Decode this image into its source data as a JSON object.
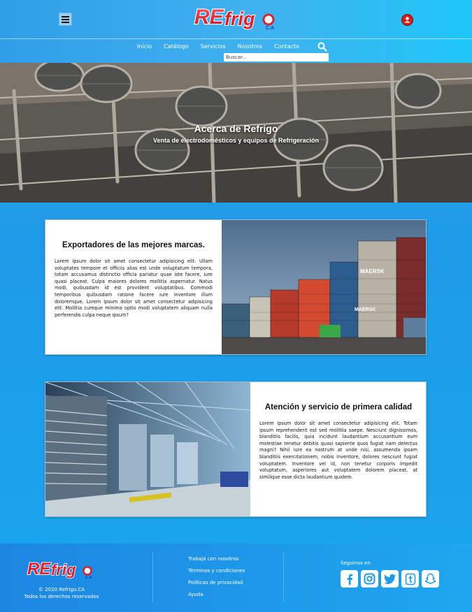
{
  "header": {
    "logo_text": "REfrigo",
    "logo_suffix": "C.A",
    "nav": [
      "Inicio",
      "Catálogo",
      "Servicios",
      "Nosotros",
      "Contacto"
    ],
    "search_placeholder": "Buscar..."
  },
  "hero": {
    "title": "Acerca de Refrigo",
    "subtitle": "Venta de electrodomésticos y equipos de Refrigeración"
  },
  "cards": [
    {
      "title": "Exportadores de las mejores marcas.",
      "body": "Lorem ipsum dolor sit amet consectetur adipisicing elit. Ullam voluptates tempore et officiis alias est unde voluptatum tempora, totam accusamus distinctio officia pariatur quae iste facere, iure quasi placeat. Culpa maiores dolores mollitia aspernatur. Natus modi, quibusdam id est provident voluptatibus. Commodi temporibus quibusdam ratione facere iure inventore illum doloremque. Lorem ipsum dolor sit amet consectetur adipisicing elit. Mollitia cumque minima optio modi voluptatem aliquam nulla perferendis culpa neque ipsum?"
    },
    {
      "title": "Atención y servicio de primera calidad",
      "body": "Lorem ipsum dolor sit amet consectetur adipisicing elit. Totam ipsum reprehenderit est sed mollitia saepe. Nesciunt dignissimos, blanditiis facilis, quia incidunt laudantium accusantium eum molestiae tenetur debitis quasi sapiente quos fugiat nam delectus magni? Nihil iure ea nostrum at unde nisi, assumenda ipsam blanditiis exercitationem, nobis inventore, dolores nesciunt fugiat voluptatem. Inventore vel id, non tenetur corporis impedit voluptatum, asperiores aut voluptatem dolorem placeat, at similique esse dicta laudantium quidem."
    }
  ],
  "footer": {
    "logo_text": "REfrigo",
    "logo_suffix": "C.A",
    "copyright": "© 2020 Refrigo.CA",
    "rights": "Todos los derechos reservados",
    "links": [
      "Trabajá con nosotros",
      "Términos y condiciones",
      "Políticas de privacidad",
      "Ayuda"
    ],
    "follow_label": "Seguinos en",
    "socials": [
      "facebook-icon",
      "instagram-icon",
      "twitter-icon",
      "tumblr-icon",
      "snapchat-icon"
    ]
  },
  "colors": {
    "brand_red": "#e01f2d",
    "brand_blue": "#1d3fa8",
    "accent_blue": "#1e9be8"
  }
}
